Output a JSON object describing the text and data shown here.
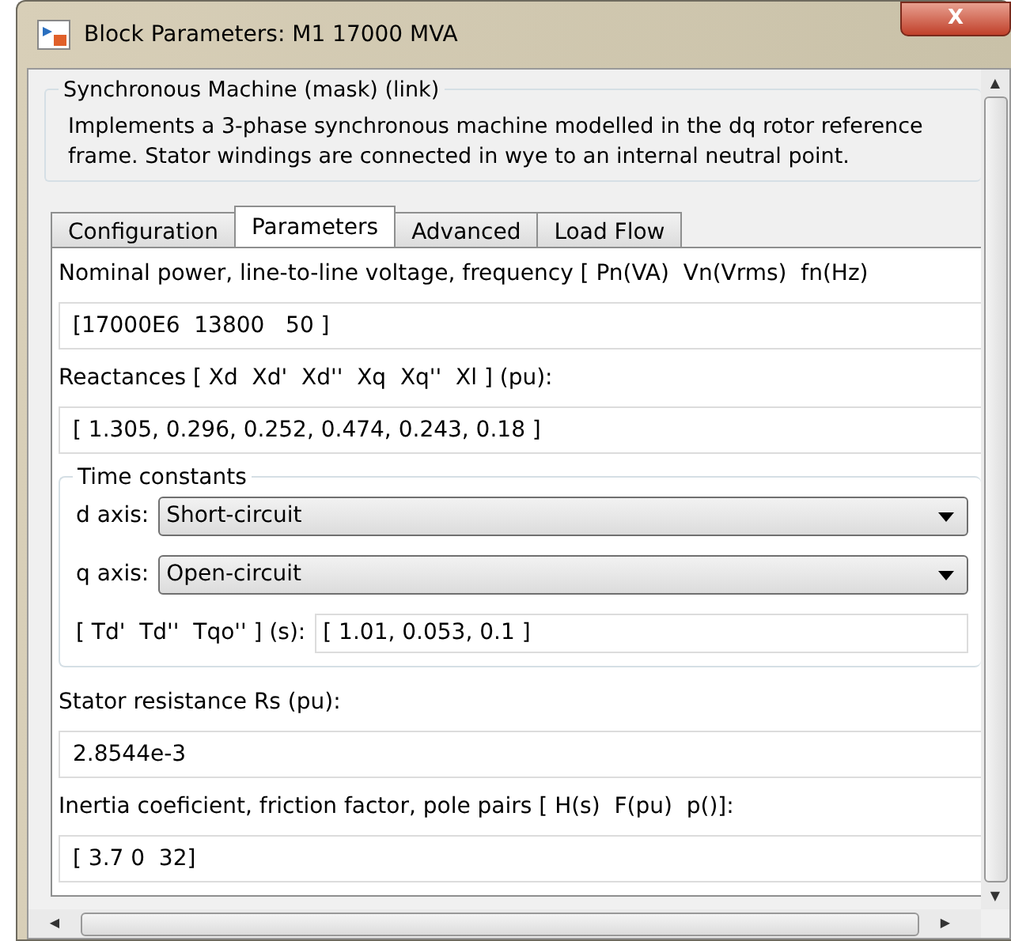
{
  "window": {
    "title": "Block Parameters: M1 17000 MVA",
    "close_label": "X"
  },
  "mask": {
    "title": "Synchronous Machine (mask) (link)",
    "description": "Implements a 3-phase synchronous machine modelled in the dq rotor reference frame. Stator windings are connected in wye to an internal neutral point."
  },
  "tabs": [
    {
      "label": "Configuration",
      "selected": false
    },
    {
      "label": "Parameters",
      "selected": true
    },
    {
      "label": "Advanced",
      "selected": false
    },
    {
      "label": "Load Flow",
      "selected": false
    }
  ],
  "params_before": [
    {
      "label": "Nominal power, line-to-line voltage, frequency [ Pn(VA)  Vn(Vrms)  fn(Hz)",
      "value": "[17000E6  13800   50 ]"
    },
    {
      "label": "Reactances [ Xd  Xd'  Xd''  Xq  Xq''  Xl ] (pu):",
      "value": "[ 1.305, 0.296, 0.252, 0.474, 0.243, 0.18 ]"
    }
  ],
  "time_constants": {
    "title": "Time constants",
    "rows": [
      {
        "kind": "dropdown",
        "label": "d axis:",
        "value": "Short-circuit"
      },
      {
        "kind": "dropdown",
        "label": "q axis:",
        "value": "Open-circuit"
      },
      {
        "kind": "text",
        "label": "[ Td'  Td''  Tqo'' ] (s):",
        "value": "[ 1.01, 0.053, 0.1 ]"
      }
    ]
  },
  "params_after": [
    {
      "label": "Stator resistance Rs (pu):",
      "value": "2.8544e-3"
    },
    {
      "label": "Inertia coeficient, friction factor, pole pairs [ H(s)  F(pu)  p()]:",
      "value": "[ 3.7 0  32]"
    }
  ],
  "scrollbars": {
    "vertical_arrow_up": "▲",
    "vertical_arrow_down": "▼",
    "horizontal_left": "◀",
    "horizontal_right": "▶"
  }
}
